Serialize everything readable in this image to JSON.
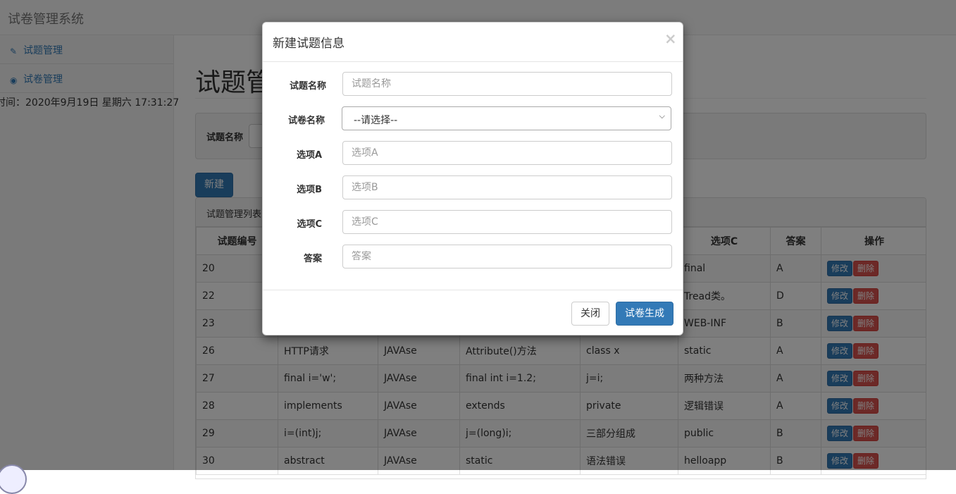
{
  "navbar": {
    "brand": "试卷管理系统"
  },
  "sidebar": {
    "items": [
      {
        "label": "试题管理",
        "icon": "edit-icon"
      },
      {
        "label": "试卷管理",
        "icon": "dashboard-icon"
      }
    ],
    "time": "时间：2020年9月19日 星期六 17:31:27"
  },
  "main": {
    "title": "试题管",
    "search": {
      "label": "试题名称"
    },
    "new_button": "新建",
    "list": {
      "heading": "试题管理列表",
      "headers": [
        "试题编号",
        "",
        "",
        "",
        "",
        "选项C",
        "答案",
        "操作"
      ],
      "rows": [
        {
          "id": "20",
          "name": "",
          "paper": "",
          "a": "",
          "b": "",
          "c": "final",
          "answer": "A"
        },
        {
          "id": "22",
          "name": "",
          "paper": "",
          "a": "",
          "b": "",
          "c": "Tread类。",
          "answer": "D"
        },
        {
          "id": "23",
          "name": "",
          "paper": "",
          "a": "",
          "b": "",
          "c": "WEB-INF",
          "answer": "B"
        },
        {
          "id": "26",
          "name": "HTTP请求",
          "paper": "JAVAse",
          "a": "Attribute()方法",
          "b": "class x",
          "c": "static",
          "answer": "A"
        },
        {
          "id": "27",
          "name": "final i='w';",
          "paper": "JAVAse",
          "a": "final int i=1.2;",
          "b": "j=i;",
          "c": "两种方法",
          "answer": "A"
        },
        {
          "id": "28",
          "name": "implements",
          "paper": "JAVAse",
          "a": "extends",
          "b": "private",
          "c": "逻辑错误",
          "answer": "A"
        },
        {
          "id": "29",
          "name": "i=(int)j;",
          "paper": "JAVAse",
          "a": "j=(long)i;",
          "b": "三部分组成",
          "c": "public",
          "answer": "B"
        },
        {
          "id": "30",
          "name": "abstract",
          "paper": "JAVAse",
          "a": "static",
          "b": "语法错误",
          "c": "helloapp",
          "answer": "B"
        }
      ],
      "edit_label": "修改",
      "delete_label": "删除"
    }
  },
  "modal": {
    "title": "新建试题信息",
    "close_symbol": "×",
    "fields": {
      "question_name": {
        "label": "试题名称",
        "placeholder": "试题名称"
      },
      "paper_name": {
        "label": "试卷名称",
        "selected": "--请选择--"
      },
      "option_a": {
        "label": "选项A",
        "placeholder": "选项A"
      },
      "option_b": {
        "label": "选项B",
        "placeholder": "选项B"
      },
      "option_c": {
        "label": "选项C",
        "placeholder": "选项C"
      },
      "answer": {
        "label": "答案",
        "placeholder": "答案"
      }
    },
    "close_button": "关闭",
    "submit_button": "试卷生成"
  },
  "colors": {
    "primary": "#337ab7",
    "danger": "#d9534f",
    "backdrop": "rgba(0,0,0,0.5)"
  }
}
